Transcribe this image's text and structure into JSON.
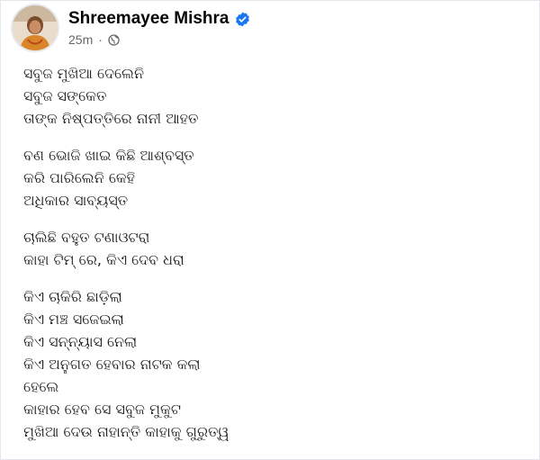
{
  "post": {
    "author": {
      "name": "Shreemayee Mishra",
      "verified_icon": "verified-badge-icon",
      "timestamp": "25m",
      "separator": "·",
      "audience_icon": "globe-icon"
    },
    "colors": {
      "verified": "#1877f2",
      "meta_text": "#65676b",
      "text": "#1c1e21"
    },
    "stanzas": [
      [
        "ସବୁଜ ମୁଖିଆ ଦେଲେନି",
        "ସବୁଜ ସଙ୍କେତ",
        "ତାଙ୍କ ନିଷ୍ପତ୍ତିରେ ନାନୀ ଆହତ"
      ],
      [
        "ବଣ ଭୋଜି ଖାଇ କିଛି ଆଶ୍ବସ୍ତ",
        "କରି ପାରିଲେନି କେହି",
        "ଅଧିକାର ସାବ୍ୟସ୍ତ"
      ],
      [
        "ଚାଲିଛି ବହୁତ ଟଣାଓଟରା",
        "କାହା ଟିମ୍ ରେ, କିଏ ଦେବ ଧରା"
      ],
      [
        "କିଏ ଚାକିରି ଛାଡ଼ିଲା",
        "କିଏ ମଞ୍ଚ ସଜେଇଲା",
        "କିଏ ସନ୍ନ୍ୟାସ ନେଲା",
        "କିଏ ଅନୁଗତ ହେବାର ନାଟକ କଲା",
        "ହେଲେ",
        "କାହାର ହେବ ସେ ସବୁଜ ମୁକୁଟ",
        "ମୁଖିଆ ଦେଉ ନାହାନ୍ତି କାହାକୁ ଗୁରୁତ୍ୱ"
      ]
    ]
  }
}
